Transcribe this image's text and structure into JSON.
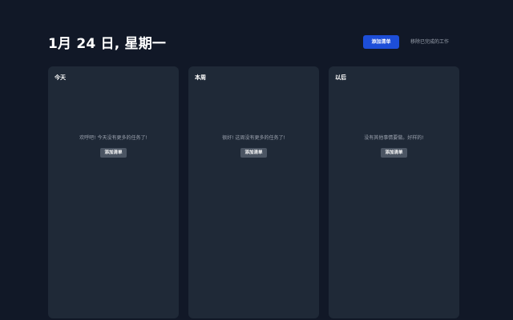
{
  "header": {
    "title": "1月 24 日, 星期一",
    "add_list_label": "添加清单",
    "remove_done_label": "移除已完成的工作"
  },
  "columns": [
    {
      "title": "今天",
      "empty_message": "欢呼吧! 今天没有更多的任务了!",
      "add_label": "添加清单"
    },
    {
      "title": "本周",
      "empty_message": "很好! 这周没有更多的任务了!",
      "add_label": "添加清单"
    },
    {
      "title": "以后",
      "empty_message": "没有其他事情要做。好样的!",
      "add_label": "添加清单"
    }
  ],
  "colors": {
    "background": "#111827",
    "card": "#1f2937",
    "primary": "#1d4ed8",
    "secondary_button": "#4b5563",
    "muted_text": "#9ca3af"
  }
}
